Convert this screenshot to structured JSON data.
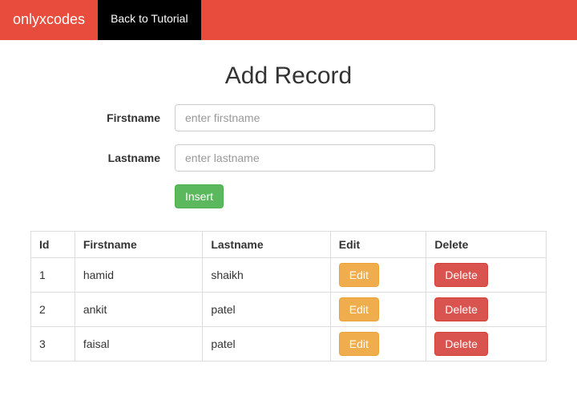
{
  "navbar": {
    "brand": "onlyxcodes",
    "back_label": "Back to Tutorial"
  },
  "page_title": "Add Record",
  "form": {
    "firstname_label": "Firstname",
    "firstname_placeholder": "enter firstname",
    "lastname_label": "Lastname",
    "lastname_placeholder": "enter lastname",
    "insert_label": "Insert"
  },
  "table": {
    "headers": {
      "id": "Id",
      "firstname": "Firstname",
      "lastname": "Lastname",
      "edit": "Edit",
      "delete": "Delete"
    },
    "edit_label": "Edit",
    "delete_label": "Delete",
    "rows": [
      {
        "id": "1",
        "firstname": "hamid",
        "lastname": "shaikh"
      },
      {
        "id": "2",
        "firstname": "ankit",
        "lastname": "patel"
      },
      {
        "id": "3",
        "firstname": "faisal",
        "lastname": "patel"
      }
    ]
  }
}
